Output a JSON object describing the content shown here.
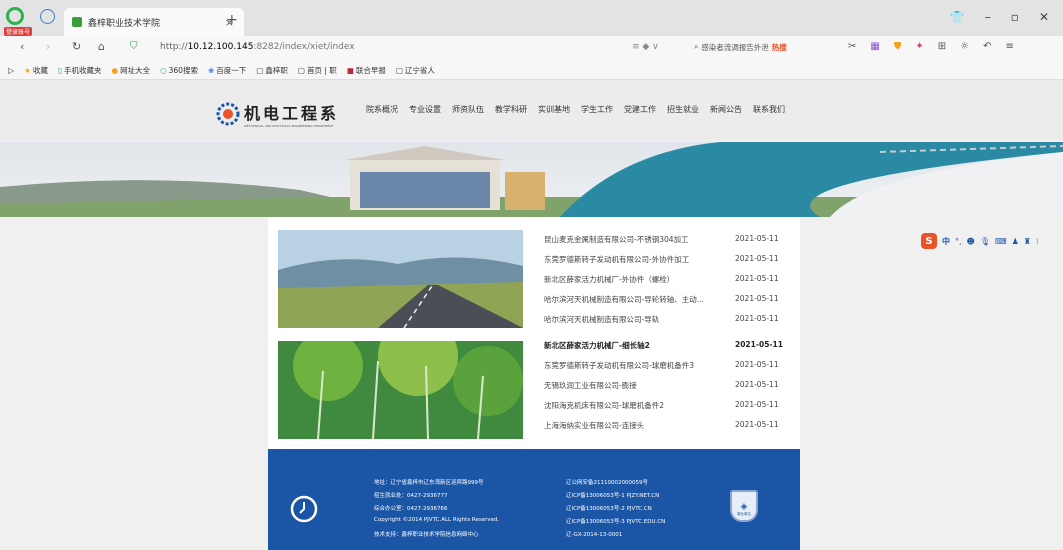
{
  "browser": {
    "tab_title": "鑫梓职业技术学院",
    "tab_badge": "登录账号",
    "url_prefix": "http://",
    "url_host": "10.12.100.145",
    "url_rest": ":8282/index/xiet/index",
    "search_text": "感染者流调报告外泄",
    "hot_label": "热搜",
    "bookmarks": [
      "收藏",
      "手机收藏夹",
      "网址大全",
      "360搜索",
      "百度一下",
      "鑫梓职",
      "首页 | 职",
      "联合早报",
      "辽宁省人"
    ]
  },
  "site": {
    "logo_text": "机电工程系",
    "logo_subtext": "MECHANICAL AND ELECTRICAL ENGINEERING DEPARTMENT",
    "nav": [
      "院系概况",
      "专业设置",
      "师资队伍",
      "教学科研",
      "实训基地",
      "学生工作",
      "党建工作",
      "招生就业",
      "新闻公告",
      "联系我们"
    ]
  },
  "news_list": [
    {
      "title": "昆山麦克金属制造有限公司-不锈钢304加工",
      "date": "2021-05-11"
    },
    {
      "title": "东莞罗德斯转子发动机有限公司-外协件加工",
      "date": "2021-05-11"
    },
    {
      "title": "新北区薛家活力机械厂-外协件（螺栓）",
      "date": "2021-05-11"
    },
    {
      "title": "哈尔滨河天机械制造有限公司-导轮转轴、主动...",
      "date": "2021-05-11"
    },
    {
      "title": "哈尔滨河天机械制造有限公司-导轨",
      "date": "2021-05-11"
    },
    {
      "title": "新北区薛家活力机械厂-细长轴2",
      "date": "2021-05-11"
    },
    {
      "title": "东莞罗德斯转子发动机有限公司-球磨机备件3",
      "date": "2021-05-11"
    },
    {
      "title": "无锡玖润工业有限公司-膨接",
      "date": "2021-05-11"
    },
    {
      "title": "沈阳海克机床有限公司-球磨机备件2",
      "date": "2021-05-11"
    },
    {
      "title": "上海海纳实业有限公司-连接头",
      "date": "2021-05-11"
    }
  ],
  "footer": {
    "left": [
      "地址：辽宁省鑫梓市辽东湾新区迎宾路999号",
      "招生就业处：0427-2936777",
      "综合办公室：0427-2936766",
      "Copyright ©2014 PJVTC.ALL Rights Reserved.",
      "技术支持：鑫梓职业技术学院信息网络中心"
    ],
    "right": [
      "辽公网安备21110002000059号",
      "辽ICP备13006053号-1 PJZY.NET.CN",
      "辽ICP备13006053号-2 PJVTC.CN",
      "辽ICP备13006053号-3 PJVTC.EDU.CN",
      "辽-GX-2014-13-0001"
    ],
    "badge_text": "事业单位"
  },
  "sogou": {
    "label": "中"
  },
  "colors": {
    "footer_bg": "#1b56a6",
    "accent_orange": "#e8542a",
    "banner_teal": "#2a8aa4"
  }
}
